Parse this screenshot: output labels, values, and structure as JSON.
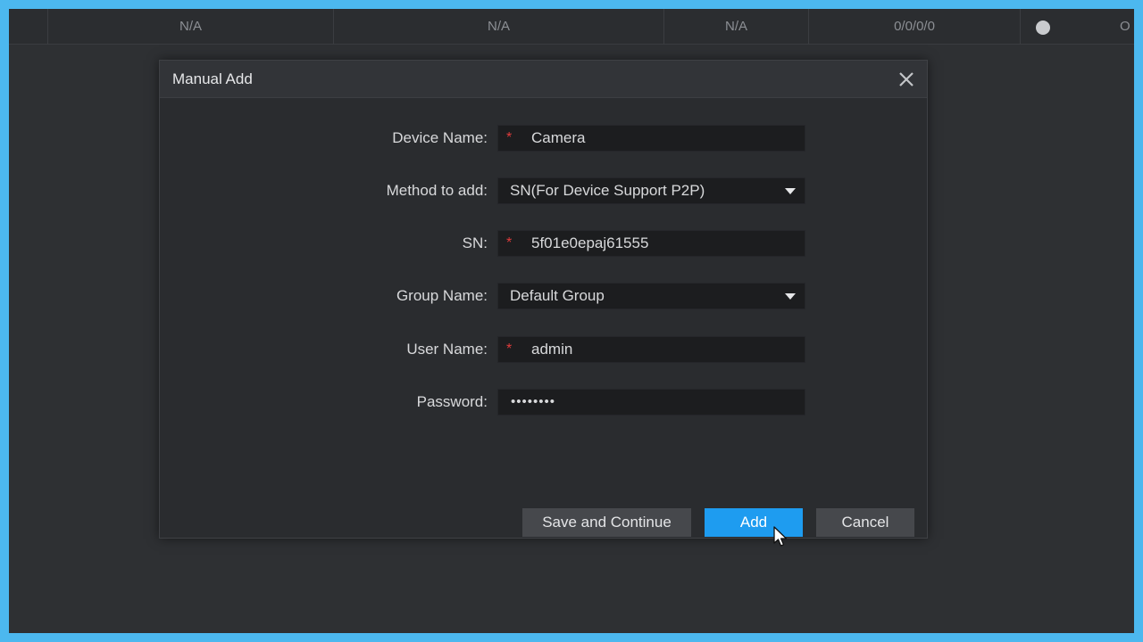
{
  "table_row": {
    "cells": [
      "N/A",
      "N/A",
      "N/A",
      "0/0/0/0"
    ],
    "clipped_text": "O"
  },
  "dialog": {
    "title": "Manual Add",
    "fields": {
      "device_name": {
        "label": "Device Name:",
        "value": "Camera",
        "required": "*"
      },
      "method": {
        "label": "Method to add:",
        "value": "SN(For Device Support P2P)"
      },
      "sn": {
        "label": "SN:",
        "value": "5f01e0epaj61555",
        "required": "*"
      },
      "group": {
        "label": "Group Name:",
        "value": "Default Group"
      },
      "user_name": {
        "label": "User Name:",
        "value": "admin",
        "required": "*"
      },
      "password": {
        "label": "Password:",
        "value": "••••••••"
      }
    },
    "buttons": {
      "save_continue": "Save and Continue",
      "add": "Add",
      "cancel": "Cancel"
    }
  },
  "colors": {
    "accent": "#1e9cf0",
    "frame": "#4cb8ef",
    "required": "#e03b3b"
  },
  "icons": {
    "close": "close-icon",
    "dropdown": "chevron-down-icon",
    "cursor": "mouse-pointer-icon"
  }
}
